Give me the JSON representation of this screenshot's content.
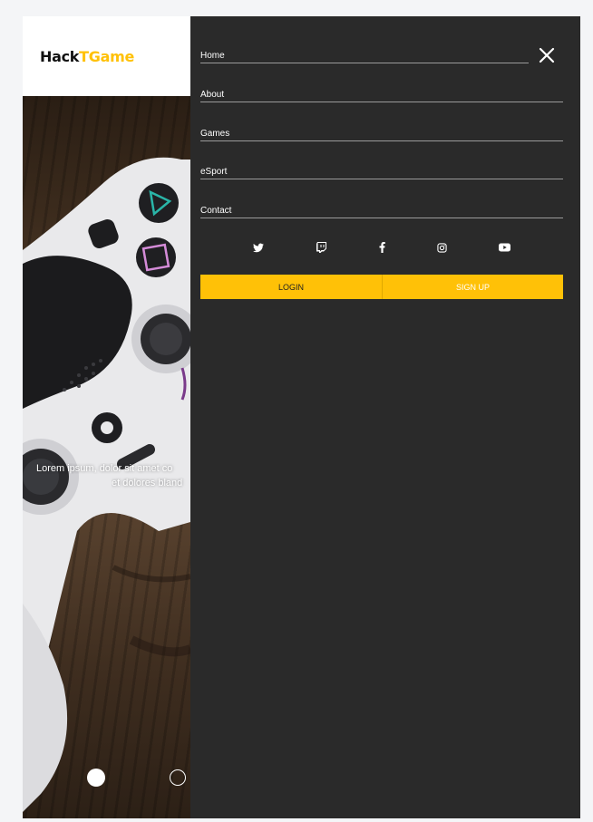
{
  "brand": {
    "part1": "Hack",
    "part2": "TGame",
    "accent_color": "#ffc107"
  },
  "hero": {
    "line1": "Lorem ipsum, dolor sit amet co",
    "line2": "et dolores bland",
    "slides": {
      "active_index": 0,
      "count": 2
    }
  },
  "menu": {
    "items": [
      {
        "label": "Home"
      },
      {
        "label": "About"
      },
      {
        "label": "Games"
      },
      {
        "label": "eSport"
      },
      {
        "label": "Contact"
      }
    ],
    "close_icon": "close-icon"
  },
  "socials": [
    {
      "icon": "twitter-icon"
    },
    {
      "icon": "twitch-icon"
    },
    {
      "icon": "facebook-icon"
    },
    {
      "icon": "instagram-icon"
    },
    {
      "icon": "youtube-icon"
    }
  ],
  "buttons": {
    "login": "LOGIN",
    "signup": "SIGN UP"
  },
  "colors": {
    "panel_bg": "#2a2a2a",
    "button_bg": "#ffc107"
  }
}
